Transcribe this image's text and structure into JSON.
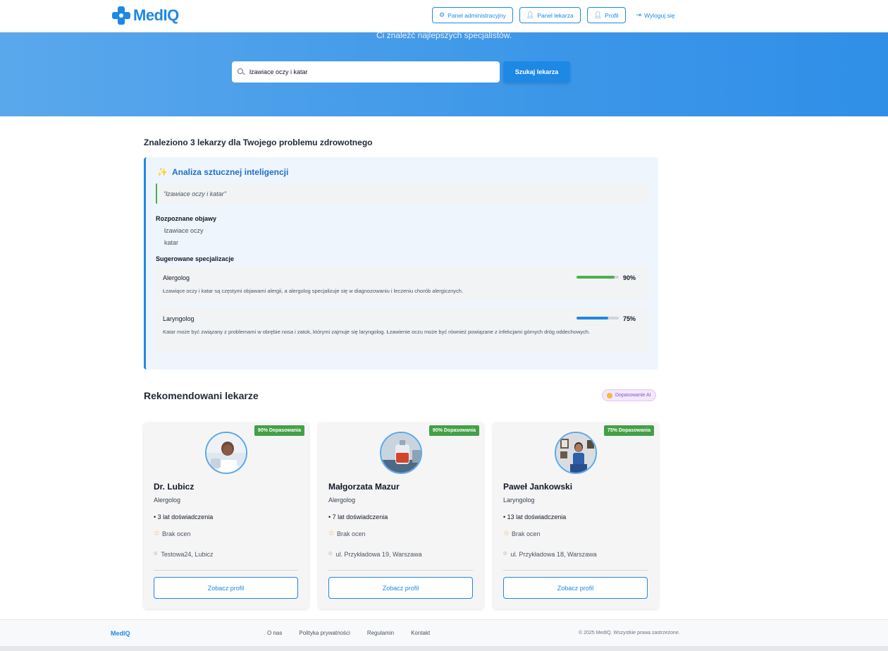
{
  "brand": {
    "name": "MedIQ",
    "color": "#1e88e5"
  },
  "nav": {
    "admin_panel": "Panel administracyjny",
    "doctor_panel": "Panel lekarza",
    "profile": "Profil",
    "logout": "Wyloguj się"
  },
  "hero": {
    "subtitle": "Ci znaleźć najlepszych specjalistów.",
    "search_value": "łzawiace oczy i katar",
    "search_button": "Szukaj lekarza"
  },
  "results": {
    "title": "Znaleziono 3 lekarzy dla Twojego problemu zdrowotnego"
  },
  "analysis": {
    "title": "Analiza sztucznej inteligencji",
    "query": "\"łzawiace oczy i katar\"",
    "symptoms_label": "Rozpoznane objawy",
    "symptoms": [
      "łzawiace oczy",
      "katar"
    ],
    "specializations_label": "Sugerowane specjalizacje",
    "specializations": [
      {
        "name": "Alergolog",
        "match": 0.9,
        "match_label": "90%",
        "color": "#4caf50",
        "description": "Łzawiące oczy i katar są częstymi objawami alergii, a alergolog specjalizuje się w diagnozowaniu i leczeniu chorób alergicznych."
      },
      {
        "name": "Laryngolog",
        "match": 0.75,
        "match_label": "75%",
        "color": "#1e88e5",
        "description": "Katar może być związany z problemami w obrębie nosa i zatok, którymi zajmuje się laryngolog. Łzawienie oczu może być również powiązane z infekcjami górnych dróg oddechowych."
      }
    ]
  },
  "recommended": {
    "title": "Rekomendowani lekarze",
    "ai_badge": "Dopasowanie AI",
    "doctors": [
      {
        "match": "90% Dopasowania",
        "name": "Dr. Lubicz",
        "specialty": "Alergolog",
        "experience": "• 3 lat doświadczenia",
        "rating": "Brak ocen",
        "address": "Testowa24, Lubicz",
        "button": "Zobacz profil"
      },
      {
        "match": "90% Dopasowania",
        "name": "Małgorzata Mazur",
        "specialty": "Alergolog",
        "experience": "• 7 lat doświadczenia",
        "rating": "Brak ocen",
        "address": "ul. Przykładowa 19, Warszawa",
        "button": "Zobacz profil"
      },
      {
        "match": "75% Dopasowania",
        "name": "Paweł Jankowski",
        "specialty": "Laryngolog",
        "experience": "• 13 lat doświadczenia",
        "rating": "Brak ocen",
        "address": "ul. Przykładowa 18, Warszawa",
        "button": "Zobacz profil"
      }
    ]
  },
  "footer": {
    "brand": "MedIQ",
    "links": [
      "O nas",
      "Polityka prywatności",
      "Regulamin",
      "Kontakt"
    ],
    "copyright": "© 2025 MedIQ. Wszystkie prawa zastrzeżone."
  }
}
